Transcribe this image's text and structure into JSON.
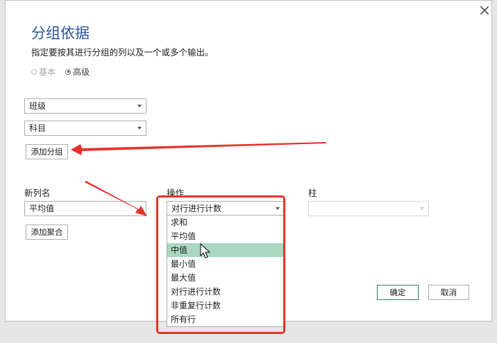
{
  "dialog": {
    "title": "分组依据",
    "subtitle": "指定要按其进行分组的列以及一个或多个输出。",
    "mode": {
      "basic_label": "基本",
      "advanced_label": "高级",
      "selected": "高级"
    },
    "group_by": {
      "select_1_value": "班级",
      "select_2_value": "科目",
      "add_group_label": "添加分组"
    },
    "aggregation": {
      "new_column_header": "新列名",
      "operation_header": "操作",
      "column_header": "柱",
      "new_column_value": "平均值",
      "operation_value": "对行进行计数",
      "column_value": "",
      "add_aggregation_label": "添加聚合"
    },
    "operation_options": [
      "求和",
      "平均值",
      "中值",
      "最小值",
      "最大值",
      "对行进行计数",
      "非重复行计数",
      "所有行"
    ],
    "highlighted_option": "中值",
    "ok_label": "确定",
    "cancel_label": "取消"
  },
  "colors": {
    "title": "#2b5797",
    "highlight": "#a9d7c0",
    "annotation_red": "#e8312a"
  },
  "icons": [
    "close-icon",
    "chevron-down-icon",
    "mouse-cursor-icon",
    "red-arrow-annotation"
  ]
}
